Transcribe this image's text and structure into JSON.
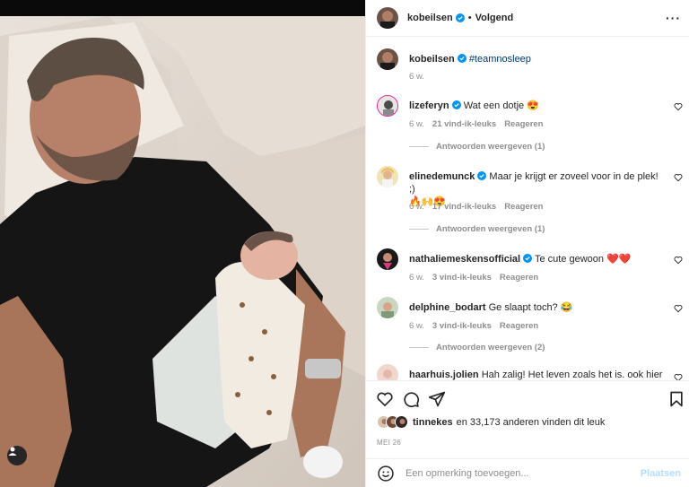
{
  "post": {
    "author": "kobeilsen",
    "follow_label": "Volgend",
    "more_icon": "more-horizontal-icon",
    "caption_author": "kobeilsen",
    "caption_text": "#teamnosleep",
    "caption_time": "6 w."
  },
  "comments": [
    {
      "user": "lizeferyn",
      "text": "Wat een dotje 😍",
      "time": "6 w.",
      "likes": "21 vind-ik-leuks",
      "reply": "Reageren",
      "view_replies": "Antwoorden weergeven (1)"
    },
    {
      "user": "elinedemunck",
      "text": "Maar je krijgt er zoveel voor in de plek! ;)",
      "text2": "🔥🙌😍",
      "time": "6 w.",
      "likes": "17 vind-ik-leuks",
      "reply": "Reageren",
      "view_replies": "Antwoorden weergeven (1)"
    },
    {
      "user": "nathaliemeskensofficial",
      "text": "Te cute gewoon ❤️❤️",
      "time": "6 w.",
      "likes": "3 vind-ik-leuks",
      "reply": "Reageren"
    },
    {
      "user": "delphine_bodart",
      "text": "Ge slaapt toch? 😂",
      "time": "6 w.",
      "likes": "3 vind-ik-leuks",
      "reply": "Reageren",
      "view_replies": "Antwoorden weergeven (2)"
    },
    {
      "user": "haarhuis.jolien",
      "text": "Hah zalig! Het leven zoals het is. ook hier"
    }
  ],
  "likes_bar": {
    "user": "tinnekes",
    "rest": "en 33,173 anderen vinden dit leuk"
  },
  "date": "MEI 26",
  "add_comment": {
    "placeholder": "Een opmerking toevoegen...",
    "post_label": "Plaatsen"
  },
  "colors": {
    "verified": "#0095f6",
    "link": "#00376b",
    "muted": "#8e8e8e",
    "post_disabled": "#b2dffc"
  }
}
